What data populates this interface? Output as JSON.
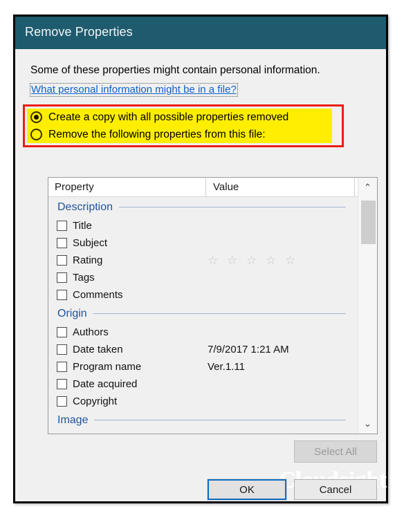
{
  "window": {
    "title": "Remove Properties"
  },
  "intro": {
    "text": "Some of these properties might contain personal information.",
    "help_link": "What personal information might be in a file?"
  },
  "options": {
    "selected_index": 0,
    "items": [
      {
        "label": "Create a copy with all possible properties removed",
        "checked": true
      },
      {
        "label": "Remove the following properties from this file:",
        "checked": false
      }
    ]
  },
  "list": {
    "columns": {
      "property": "Property",
      "value": "Value"
    },
    "groups": [
      {
        "title": "Description",
        "rows": [
          {
            "name": "Title",
            "value": "",
            "checked": false,
            "stars": 0
          },
          {
            "name": "Subject",
            "value": "",
            "checked": false,
            "stars": 0
          },
          {
            "name": "Rating",
            "value": "",
            "checked": false,
            "stars": 5,
            "stars_text": "☆ ☆ ☆ ☆ ☆"
          },
          {
            "name": "Tags",
            "value": "",
            "checked": false,
            "stars": 0
          },
          {
            "name": "Comments",
            "value": "",
            "checked": false,
            "stars": 0
          }
        ]
      },
      {
        "title": "Origin",
        "rows": [
          {
            "name": "Authors",
            "value": "",
            "checked": false,
            "stars": 0
          },
          {
            "name": "Date taken",
            "value": "7/9/2017 1:21 AM",
            "checked": false,
            "stars": 0
          },
          {
            "name": "Program name",
            "value": "Ver.1.11",
            "checked": false,
            "stars": 0
          },
          {
            "name": "Date acquired",
            "value": "",
            "checked": false,
            "stars": 0
          },
          {
            "name": "Copyright",
            "value": "",
            "checked": false,
            "stars": 0
          }
        ]
      },
      {
        "title": "Image",
        "rows": []
      }
    ],
    "scrollbar": {
      "up_arrow": "⌃",
      "down_arrow": "⌄"
    }
  },
  "buttons": {
    "select_all": "Select All",
    "select_all_enabled": false,
    "ok": "OK",
    "cancel": "Cancel"
  },
  "watermark": {
    "text": "Cloudeight"
  },
  "colors": {
    "titlebar": "#1e5b6e",
    "highlight": "#ffee00",
    "annotation_border": "#ee1c12",
    "link": "#0f61c8",
    "group_title": "#21549c",
    "focus_border": "#0f6cc0"
  }
}
